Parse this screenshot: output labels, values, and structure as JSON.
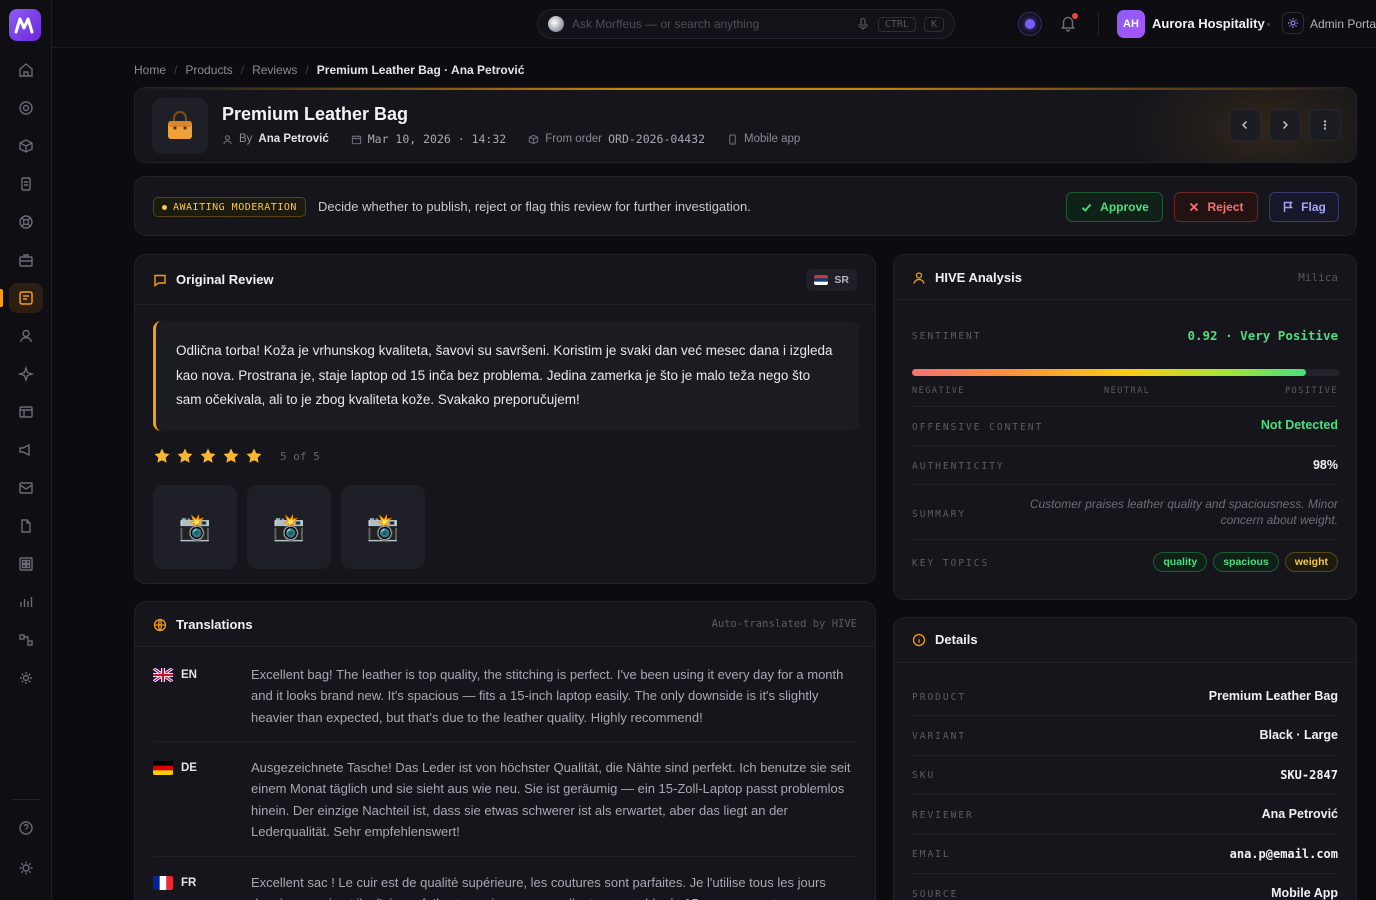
{
  "topbar": {
    "search_placeholder": "Ask Morffeus — or search anything",
    "kbd_ctrl": "CTRL",
    "kbd_k": "K",
    "avatar_initials": "AH",
    "org_name": "Aurora Hospitality",
    "admin_label": "Admin Portal"
  },
  "breadcrumb": [
    "Home",
    "Products",
    "Reviews",
    "Premium Leather Bag · Ana Petrović"
  ],
  "header": {
    "title": "Premium Leather Bag",
    "by_prefix": "By",
    "author": "Ana Petrović",
    "date": "Mar 10, 2026 · 14:32",
    "order_prefix": "From order",
    "order_id": "ORD-2026-04432",
    "source": "Mobile app"
  },
  "moderation": {
    "badge": "AWAITING MODERATION",
    "text": "Decide whether to publish, reject or flag this review for further investigation.",
    "approve": "Approve",
    "reject": "Reject",
    "flag": "Flag"
  },
  "review": {
    "title": "Original Review",
    "lang": "SR",
    "text": "Odlična torba! Koža je vrhunskog kvaliteta, šavovi su savršeni. Koristim je svaki dan već mesec dana i izgleda kao nova. Prostrana je, staje laptop od 15 inča bez problema. Jedina zamerka je što je malo teža nego što sam očekivala, ali to je zbog kvaliteta kože. Svakako preporučujem!",
    "rating": 5,
    "rating_label": "5 of 5",
    "photos": [
      "📸",
      "📸",
      "📸"
    ]
  },
  "translations": {
    "title": "Translations",
    "meta": "Auto-translated by HIVE",
    "items": [
      {
        "code": "EN",
        "text": "Excellent bag! The leather is top quality, the stitching is perfect. I've been using it every day for a month and it looks brand new. It's spacious — fits a 15-inch laptop easily. The only downside is it's slightly heavier than expected, but that's due to the leather quality. Highly recommend!"
      },
      {
        "code": "DE",
        "text": "Ausgezeichnete Tasche! Das Leder ist von höchster Qualität, die Nähte sind perfekt. Ich benutze sie seit einem Monat täglich und sie sieht aus wie neu. Sie ist geräumig — ein 15-Zoll-Laptop passt problemlos hinein. Der einzige Nachteil ist, dass sie etwas schwerer ist als erwartet, aber das liegt an der Lederqualität. Sehr empfehlenswert!"
      },
      {
        "code": "FR",
        "text": "Excellent sac ! Le cuir est de qualité supérieure, les coutures sont parfaites. Je l'utilise tous les jours depuis un mois et il a l'air neuf. Il est spacieux — un ordinateur portable de 15 pouces y entre."
      }
    ]
  },
  "hive": {
    "title": "HIVE Analysis",
    "user": "Milica",
    "sentiment_label": "SENTIMENT",
    "sentiment_value": "0.92 · Very Positive",
    "sentiment_score": 0.92,
    "scale_negative": "NEGATIVE",
    "scale_neutral": "NEUTRAL",
    "scale_positive": "POSITIVE",
    "offensive_label": "OFFENSIVE CONTENT",
    "offensive_value": "Not Detected",
    "authenticity_label": "AUTHENTICITY",
    "authenticity_value": "98%",
    "summary_label": "SUMMARY",
    "summary_value": "Customer praises leather quality and spaciousness. Minor concern about weight.",
    "topics_label": "KEY TOPICS",
    "topics": [
      "quality",
      "spacious",
      "weight"
    ]
  },
  "details": {
    "title": "Details",
    "rows": [
      {
        "label": "PRODUCT",
        "value": "Premium Leather Bag"
      },
      {
        "label": "VARIANT",
        "value": "Black · Large"
      },
      {
        "label": "SKU",
        "value": "SKU-2847"
      },
      {
        "label": "REVIEWER",
        "value": "Ana Petrović"
      },
      {
        "label": "EMAIL",
        "value": "ana.p@email.com"
      },
      {
        "label": "SOURCE",
        "value": "Mobile App"
      }
    ]
  },
  "colors": {
    "accent": "#f59e0b",
    "brand": "#8b5cf6",
    "positive": "#4ade80",
    "negative": "#f87171"
  }
}
